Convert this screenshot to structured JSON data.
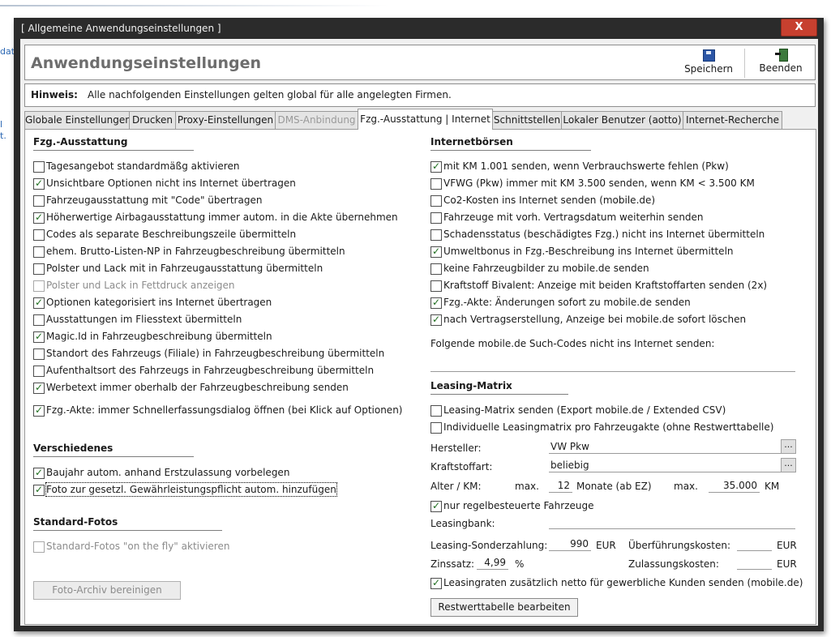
{
  "window": {
    "title": "[ Allgemeine Anwendungseinstellungen ]",
    "close_label": "X"
  },
  "background": {
    "fragments": [
      "dat",
      "l",
      "t."
    ]
  },
  "header": {
    "title": "Anwendungseinstellungen",
    "save_label": "Speichern",
    "save_icon": "floppy-disk-icon",
    "exit_label": "Beenden",
    "exit_icon": "exit-door-icon"
  },
  "hint": {
    "label": "Hinweis:",
    "text": "Alle nachfolgenden Einstellungen gelten global für alle angelegten Firmen."
  },
  "tabs": [
    {
      "label": "Globale Einstellungen",
      "state": "normal"
    },
    {
      "label": "Drucken",
      "state": "normal"
    },
    {
      "label": "Proxy-Einstellungen",
      "state": "normal"
    },
    {
      "label": "DMS-Anbindung",
      "state": "disabled"
    },
    {
      "label": "Fzg.-Ausstattung | Internet",
      "state": "active"
    },
    {
      "label": "Schnittstellen",
      "state": "normal"
    },
    {
      "label": "Lokaler Benutzer (aotto)",
      "state": "normal"
    },
    {
      "label": "Internet-Recherche",
      "state": "normal"
    }
  ],
  "left": {
    "ausstattung": {
      "title": "Fzg.-Ausstattung",
      "items": [
        {
          "label": "Tagesangebot standardmäßg aktivieren",
          "checked": false,
          "disabled": false
        },
        {
          "label": "Unsichtbare Optionen nicht ins Internet übertragen",
          "checked": true,
          "disabled": false
        },
        {
          "label": "Fahrzeugausstattung mit \"Code\" übertragen",
          "checked": false,
          "disabled": false
        },
        {
          "label": "Höherwertige Airbagausstattung immer autom. in die Akte übernehmen",
          "checked": true,
          "disabled": false
        },
        {
          "label": "Codes als separate Beschreibungszeile übermitteln",
          "checked": false,
          "disabled": false
        },
        {
          "label": "ehem. Brutto-Listen-NP in Fahrzeugbeschreibung übermitteln",
          "checked": false,
          "disabled": false
        },
        {
          "label": "Polster und Lack mit in Fahrzeugausstattung übermitteln",
          "checked": false,
          "disabled": false
        },
        {
          "label": "Polster und Lack in Fettdruck anzeigen",
          "checked": false,
          "disabled": true
        },
        {
          "label": "Optionen kategorisiert ins Internet übertragen",
          "checked": true,
          "disabled": false
        },
        {
          "label": "Ausstattungen im Fliesstext übermitteln",
          "checked": false,
          "disabled": false
        },
        {
          "label": "Magic.Id in Fahrzeugbeschreibung übermitteln",
          "checked": true,
          "disabled": false
        },
        {
          "label": "Standort des Fahrzeugs (Filiale) in Fahrzeugbeschreibung übermitteln",
          "checked": false,
          "disabled": false
        },
        {
          "label": "Aufenthaltsort des Fahrzeugs in Fahrzeugbeschreibung übermitteln",
          "checked": false,
          "disabled": false
        },
        {
          "label": "Werbetext immer oberhalb der Fahrzeugbeschreibung senden",
          "checked": true,
          "disabled": false
        },
        {
          "label": "Fzg.-Akte: immer Schnellerfassungsdialog öffnen (bei Klick auf Optionen)",
          "checked": true,
          "disabled": false
        }
      ]
    },
    "verschiedenes": {
      "title": "Verschiedenes",
      "items": [
        {
          "label": "Baujahr autom. anhand Erstzulassung vorbelegen",
          "checked": true,
          "disabled": false
        },
        {
          "label": "Foto zur gesetzl. Gewährleistungspflicht autom. hinzufügen",
          "checked": true,
          "disabled": false,
          "focused": true
        }
      ]
    },
    "standard_fotos": {
      "title": "Standard-Fotos",
      "items": [
        {
          "label": "Standard-Fotos \"on the fly\" aktivieren",
          "checked": false,
          "disabled": true
        }
      ],
      "button_label": "Foto-Archiv bereinigen"
    }
  },
  "right": {
    "internetboersen": {
      "title": "Internetbörsen",
      "items": [
        {
          "label": "mit KM 1.001 senden, wenn Verbrauchswerte fehlen (Pkw)",
          "checked": true,
          "disabled": false
        },
        {
          "label": "VFWG (Pkw) immer mit KM 3.500 senden, wenn KM < 3.500 KM",
          "checked": false,
          "disabled": false
        },
        {
          "label": "Co2-Kosten ins Internet senden (mobile.de)",
          "checked": false,
          "disabled": false
        },
        {
          "label": "Fahrzeuge mit vorh. Vertragsdatum weiterhin senden",
          "checked": false,
          "disabled": false
        },
        {
          "label": "Schadensstatus (beschädigtes Fzg.) nicht ins Internet übermitteln",
          "checked": false,
          "disabled": false
        },
        {
          "label": "Umweltbonus in Fzg.-Beschreibung ins Internet übermitteln",
          "checked": true,
          "disabled": false
        },
        {
          "label": "keine Fahrzeugbilder zu mobile.de senden",
          "checked": false,
          "disabled": false
        },
        {
          "label": "Kraftstoff Bivalent: Anzeige mit beiden Kraftstoffarten senden (2x)",
          "checked": false,
          "disabled": false
        },
        {
          "label": "Fzg.-Akte: Änderungen sofort zu mobile.de senden",
          "checked": true,
          "disabled": false
        },
        {
          "label": "nach Vertragserstellung, Anzeige bei mobile.de sofort löschen",
          "checked": true,
          "disabled": false
        }
      ],
      "such_codes_label": "Folgende mobile.de Such-Codes nicht ins Internet senden:",
      "such_codes_value": ""
    },
    "leasing": {
      "title": "Leasing-Matrix",
      "items": [
        {
          "label": "Leasing-Matrix senden (Export mobile.de / Extended CSV)",
          "checked": false,
          "disabled": false
        },
        {
          "label": "Individuelle Leasingmatrix pro Fahrzeugakte (ohne Restwerttabelle)",
          "checked": false,
          "disabled": false
        }
      ],
      "hersteller_label": "Hersteller:",
      "hersteller_value": "VW Pkw",
      "kraftstoff_label": "Kraftstoffart:",
      "kraftstoff_value": "beliebig",
      "dots": "...",
      "alter_label": "Alter / KM:",
      "max_label": "max.",
      "alter_value": "12",
      "monate_label": "Monate (ab EZ)",
      "max2_label": "max.",
      "km_value": "35.000",
      "km_unit": "KM",
      "regel_item": {
        "label": "nur regelbesteuerte Fahrzeuge",
        "checked": true,
        "disabled": false
      },
      "leasingbank_label": "Leasingbank:",
      "leasingbank_value": "",
      "sonder_label": "Leasing-Sonderzahlung:",
      "sonder_value": "990",
      "eur": "EUR",
      "ueberf_label": "Überführungskosten:",
      "ueberf_value": "",
      "zins_label": "Zinssatz:",
      "zins_value": "4,99",
      "percent": "%",
      "zulass_label": "Zulassungskosten:",
      "zulass_value": "",
      "netto_item": {
        "label": "Leasingraten zusätzlich netto für gewerbliche Kunden senden (mobile.de)",
        "checked": true,
        "disabled": false
      },
      "restwert_button": "Restwerttabelle  bearbeiten"
    }
  }
}
